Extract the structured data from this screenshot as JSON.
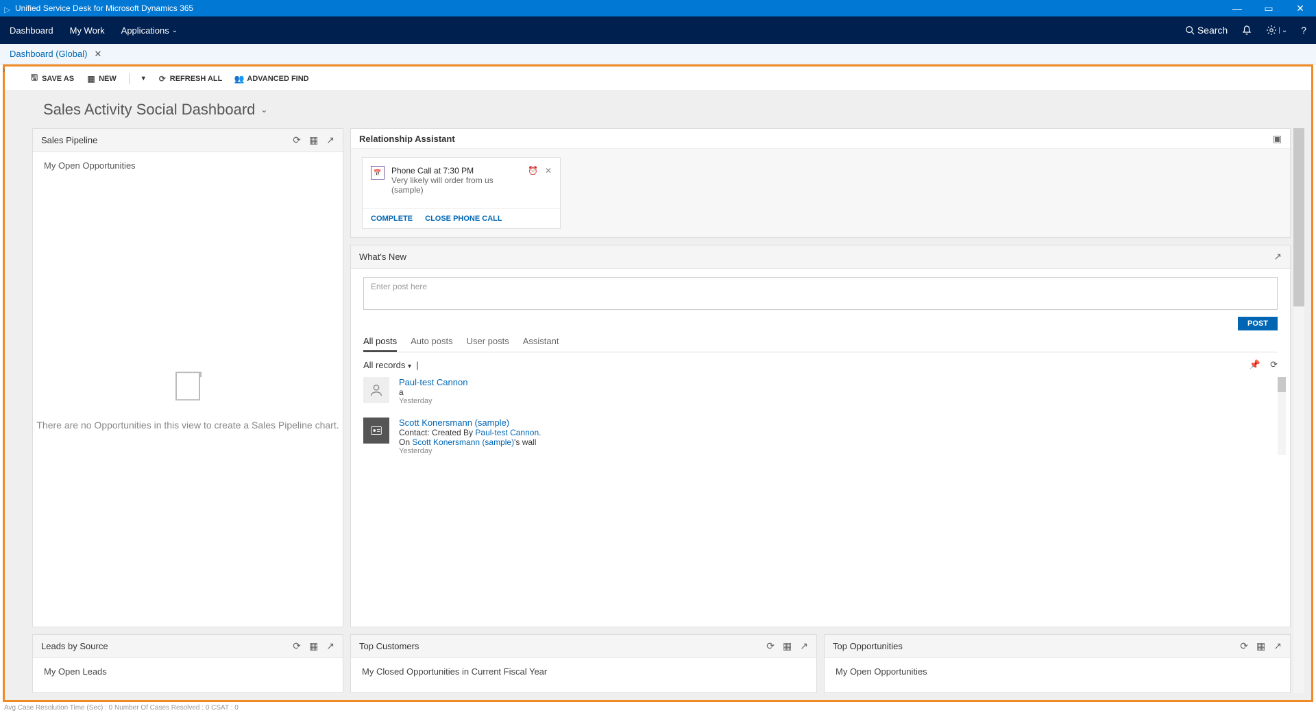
{
  "titlebar": {
    "title": "Unified Service Desk for Microsoft Dynamics 365"
  },
  "menubar": {
    "items": [
      "Dashboard",
      "My Work",
      "Applications"
    ],
    "search": "Search"
  },
  "tab": {
    "label": "Dashboard (Global)"
  },
  "toolbar": {
    "save_as": "SAVE AS",
    "new": "NEW",
    "refresh": "REFRESH ALL",
    "advanced": "ADVANCED FIND"
  },
  "dashboard": {
    "title": "Sales Activity Social Dashboard"
  },
  "sales_pipeline": {
    "title": "Sales Pipeline",
    "subtitle": "My Open Opportunities",
    "empty": "There are no Opportunities in this view to create a Sales Pipeline chart."
  },
  "relationship": {
    "title": "Relationship Assistant",
    "card": {
      "title": "Phone Call at 7:30 PM",
      "subtitle": "Very likely will order from us (sample)",
      "complete": "COMPLETE",
      "close": "CLOSE PHONE CALL"
    }
  },
  "whatsnew": {
    "title": "What's New",
    "placeholder": "Enter post here",
    "post": "POST",
    "tabs": [
      "All posts",
      "Auto posts",
      "User posts",
      "Assistant"
    ],
    "filter": "All records",
    "feed": [
      {
        "name": "Paul-test Cannon",
        "body": "a",
        "time": "Yesterday",
        "type": "user"
      },
      {
        "name": "Scott Konersmann (sample)",
        "prefix": "Contact: Created By ",
        "link": "Paul-test Cannon",
        "suffix": ".",
        "line2a": "On ",
        "line2link": "Scott Konersmann (sample)",
        "line2b": "'s wall",
        "time": "Yesterday",
        "type": "contact"
      }
    ]
  },
  "bottom": {
    "leads": {
      "title": "Leads by Source",
      "sub": "My Open Leads"
    },
    "customers": {
      "title": "Top Customers",
      "sub": "My Closed Opportunities in Current Fiscal Year"
    },
    "opps": {
      "title": "Top Opportunities",
      "sub": "My Open Opportunities"
    }
  },
  "status": "Avg Case Resolution Time (Sec) :   0   Number Of Cases Resolved :   0   CSAT :   0"
}
